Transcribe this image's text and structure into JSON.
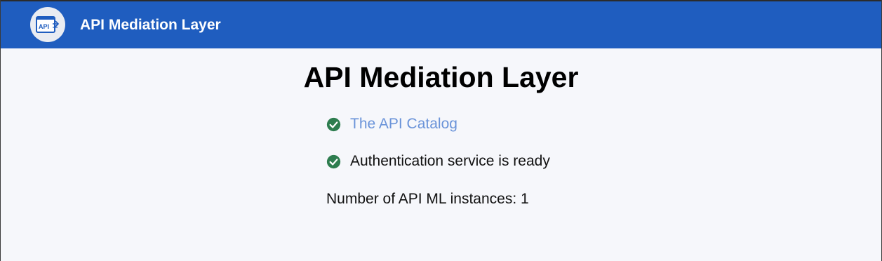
{
  "header": {
    "title": "API Mediation Layer",
    "logo_text": "API",
    "background_color": "#1f5dbf"
  },
  "main": {
    "title": "API Mediation Layer",
    "status_items": [
      {
        "icon": "check-circle-icon",
        "label": "The API Catalog",
        "is_link": true
      },
      {
        "icon": "check-circle-icon",
        "label": "Authentication service is ready",
        "is_link": false
      }
    ],
    "instances_text": "Number of API ML instances: 1"
  },
  "colors": {
    "success": "#2e7d4f",
    "link": "#6a93d9",
    "background": "#f6f7fb"
  }
}
